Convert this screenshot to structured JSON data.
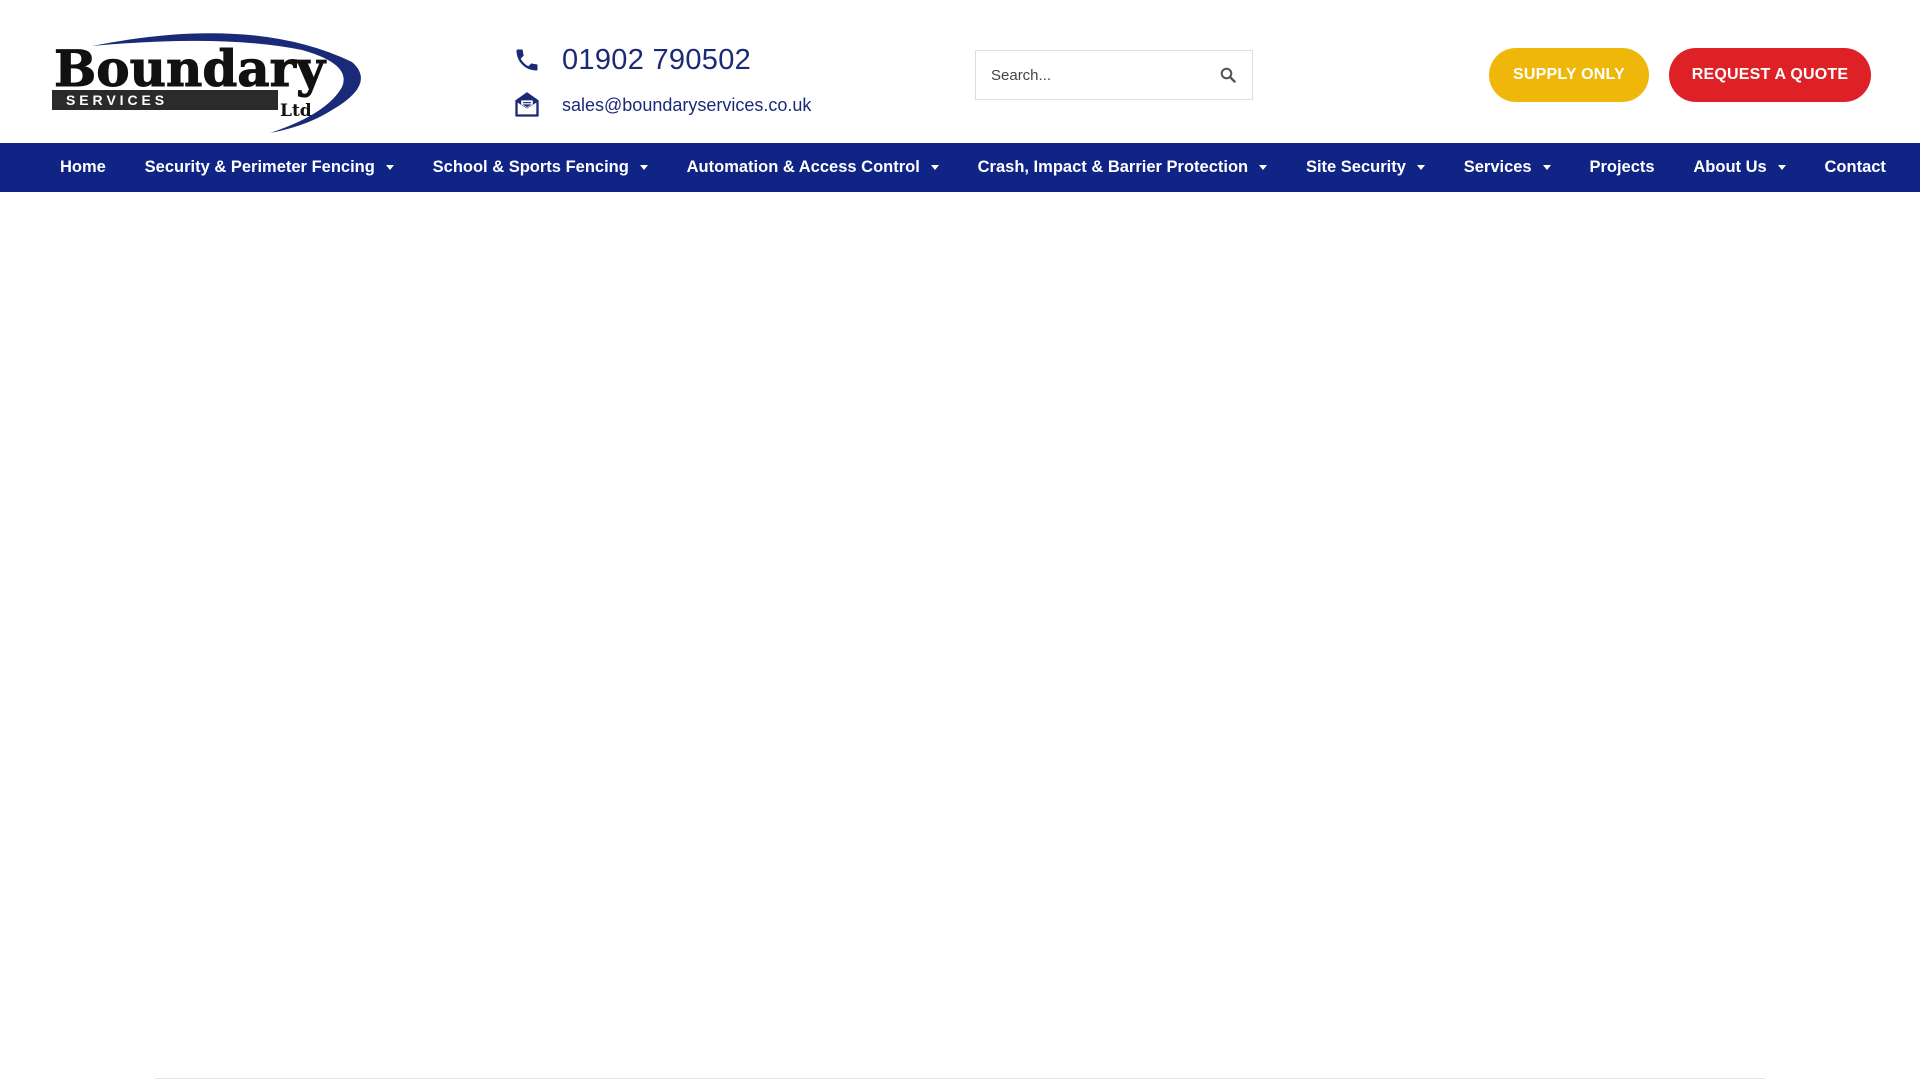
{
  "brand": {
    "logo_word": "Boundary",
    "logo_sub": "S E R V I C E S",
    "logo_ltd": "Ltd",
    "primary_color": "#0f2484",
    "text_blue": "#1b2a78"
  },
  "contact": {
    "phone": "01902 790502",
    "phone_icon": "phone-icon",
    "email": "sales@boundaryservices.co.uk",
    "email_icon": "envelope-open-icon"
  },
  "search": {
    "placeholder": "Search...",
    "icon": "search-icon"
  },
  "buttons": {
    "supply_label": "SUPPLY ONLY",
    "supply_color": "#f0b70b",
    "quote_label": "REQUEST A QUOTE",
    "quote_color": "#dd2127"
  },
  "nav": {
    "items": [
      {
        "label": "Home",
        "dropdown": false
      },
      {
        "label": "Security & Perimeter Fencing",
        "dropdown": true
      },
      {
        "label": "School & Sports Fencing",
        "dropdown": true
      },
      {
        "label": "Automation & Access Control",
        "dropdown": true
      },
      {
        "label": "Crash, Impact & Barrier Protection",
        "dropdown": true
      },
      {
        "label": "Site Security",
        "dropdown": true
      },
      {
        "label": "Services",
        "dropdown": true
      },
      {
        "label": "Projects",
        "dropdown": false
      },
      {
        "label": "About Us",
        "dropdown": true
      },
      {
        "label": "Contact",
        "dropdown": false
      }
    ]
  }
}
